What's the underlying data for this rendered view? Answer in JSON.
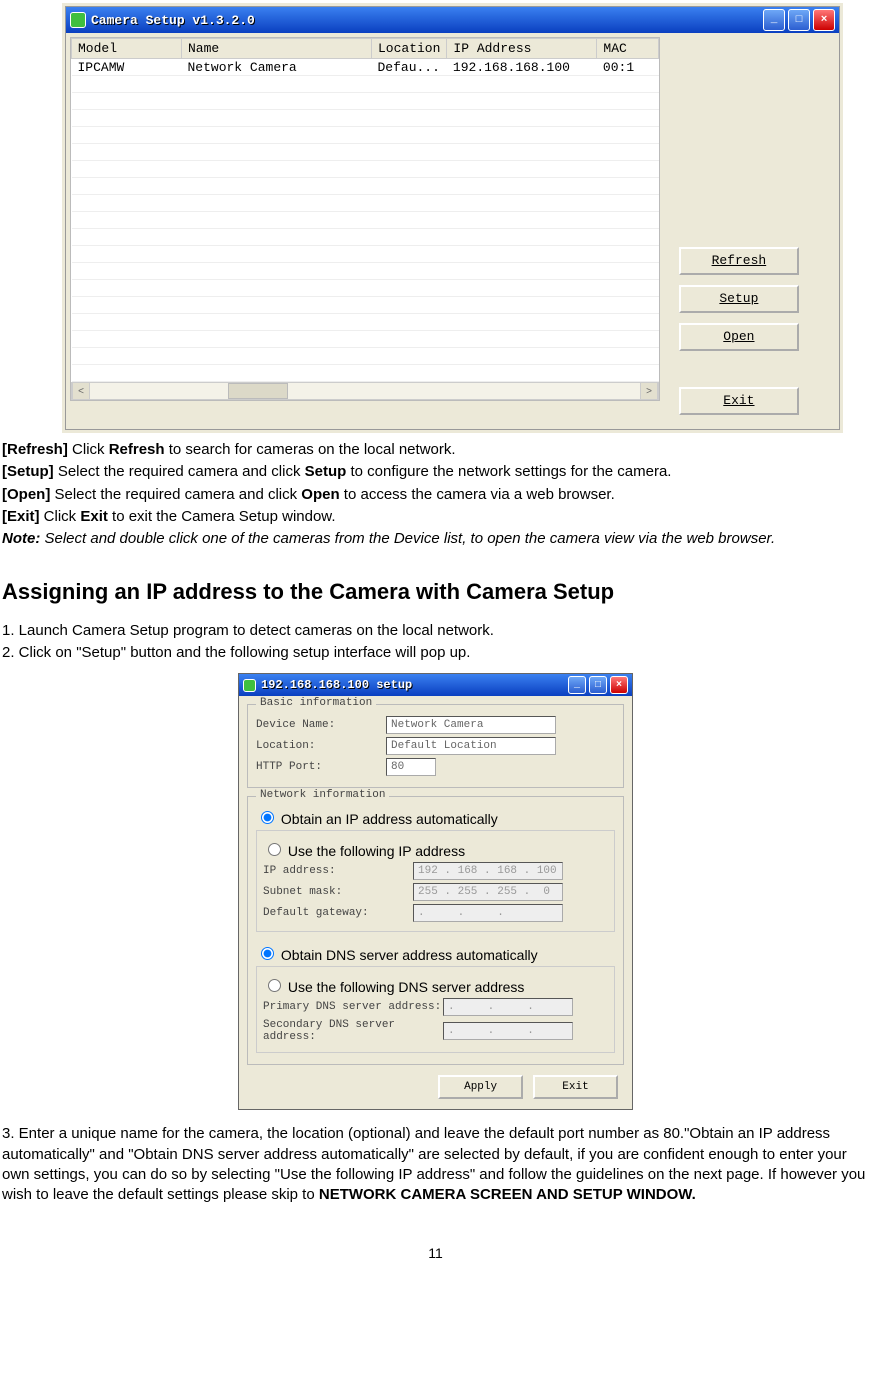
{
  "win1": {
    "title": "Camera Setup v1.3.2.0",
    "columns": [
      "Model",
      "Name",
      "Location",
      "IP Address",
      "MAC"
    ],
    "row": {
      "model": "IPCAMW",
      "name": "Network Camera",
      "location": "Defau...",
      "ip": "192.168.168.100",
      "mac": "00:1"
    },
    "buttons": {
      "refresh": "Refresh",
      "setup": "Setup",
      "open": "Open",
      "exit": "Exit"
    }
  },
  "doc1": {
    "refresh_lbl": "[Refresh]",
    "refresh_txt": " Click ",
    "refresh_b": "Refresh",
    "refresh_txt2": " to search for cameras on the local network.",
    "setup_lbl": "[Setup]",
    "setup_txt": " Select the required camera and click ",
    "setup_b": "Setup",
    "setup_txt2": " to configure the network settings for the camera.",
    "open_lbl": "[Open]",
    "open_txt": " Select the required camera and click ",
    "open_b": "Open",
    "open_txt2": " to access the camera via a web browser.",
    "exit_lbl": "[Exit]",
    "exit_txt": " Click ",
    "exit_b": "Exit",
    "exit_txt2": " to exit the Camera Setup window.",
    "note_lbl": "Note:",
    "note_txt": " Select and double click one of the cameras from the Device list, to open the camera view via the web browser."
  },
  "heading": "Assigning an IP address to the Camera with Camera Setup",
  "steps": {
    "s1": "1. Launch Camera Setup program to detect cameras on the local network.",
    "s2": "2. Click on \"Setup\" button and the following setup interface will pop up."
  },
  "win2": {
    "title": "192.168.168.100 setup",
    "basic": {
      "legend": "Basic information",
      "dn_lbl": "Device Name:",
      "dn": "Network Camera",
      "loc_lbl": "Location:",
      "loc": "Default Location",
      "port_lbl": "HTTP Port:",
      "port": "80"
    },
    "net": {
      "legend": "Network information",
      "r1": "Obtain an IP address automatically",
      "r2": "Use the following IP address",
      "ip_lbl": "IP address:",
      "ip": "192 . 168 . 168 . 100",
      "mask_lbl": "Subnet mask:",
      "mask": "255 . 255 . 255 .  0",
      "gw_lbl": "Default gateway:",
      "gw": ".     .     .",
      "r3": "Obtain DNS server address automatically",
      "r4": "Use the following DNS server address",
      "pdns_lbl": "Primary DNS server address:",
      "pdns": ".     .     .",
      "sdns_lbl": "Secondary DNS server address:",
      "sdns": ".     .     ."
    },
    "apply": "Apply",
    "exit": "Exit"
  },
  "doc2": {
    "p1a": "3. Enter a unique name for the camera, the location (optional) and leave the default port number as 80.\"Obtain an IP address automatically\" and \"Obtain DNS server address automatically\" are selected by default, if you are confident enough to enter your own settings, you can do so by selecting \"Use the following IP address\" and follow the guidelines on the next page. If however you wish to leave the default settings please skip to ",
    "p1b": "NETWORK CAMERA SCREEN AND SETUP WINDOW."
  },
  "pagenum": "11"
}
